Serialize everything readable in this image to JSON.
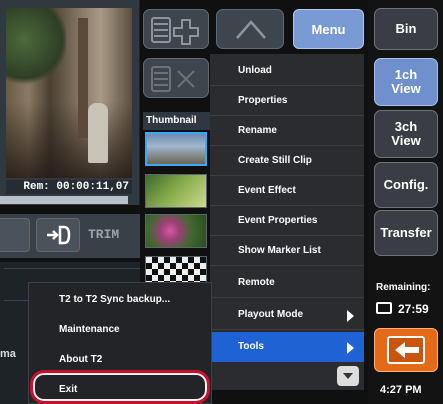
{
  "viewer": {
    "remaining_timecode": "Rem: 00:00:11,07",
    "trim_label": "TRIM",
    "partial_label": "ma"
  },
  "toolbar": {
    "add_icon": "add-list-icon",
    "up_icon": "chevron-up-icon",
    "delete_icon": "delete-list-icon",
    "menu_label": "Menu"
  },
  "thumbnails": {
    "header": "Thumbnail",
    "items": [
      "thumbnail-1",
      "thumbnail-2",
      "thumbnail-3",
      "thumbnail-4"
    ]
  },
  "menu": {
    "items": [
      {
        "label": "Unload"
      },
      {
        "label": "Properties"
      },
      {
        "label": "Rename"
      },
      {
        "label": "Create Still Clip"
      },
      {
        "label": "Event Effect"
      },
      {
        "label": "Event Properties"
      },
      {
        "label": "Show Marker List"
      },
      {
        "label": "Remote"
      },
      {
        "label": "Playout Mode"
      },
      {
        "label": "Tools"
      }
    ],
    "active_item": "Tools"
  },
  "submenu": {
    "items": [
      {
        "label": "T2 to T2 Sync backup..."
      },
      {
        "label": "Maintenance"
      },
      {
        "label": "About T2"
      },
      {
        "label": "Exit"
      }
    ]
  },
  "sidebar": {
    "bin_label": "Bin",
    "view1_label": "1ch\nView",
    "view3_label": "3ch\nView",
    "config_label": "Config.",
    "transfer_label": "Transfer",
    "remaining_label": "Remaining:",
    "remaining_time": "27:59",
    "clock": "4:27 PM"
  },
  "colors": {
    "accent_blue": "#1e62d4",
    "selected_button": "#6f90cc",
    "back_button": "#e46a18",
    "highlight_ring": "#c8102e"
  }
}
